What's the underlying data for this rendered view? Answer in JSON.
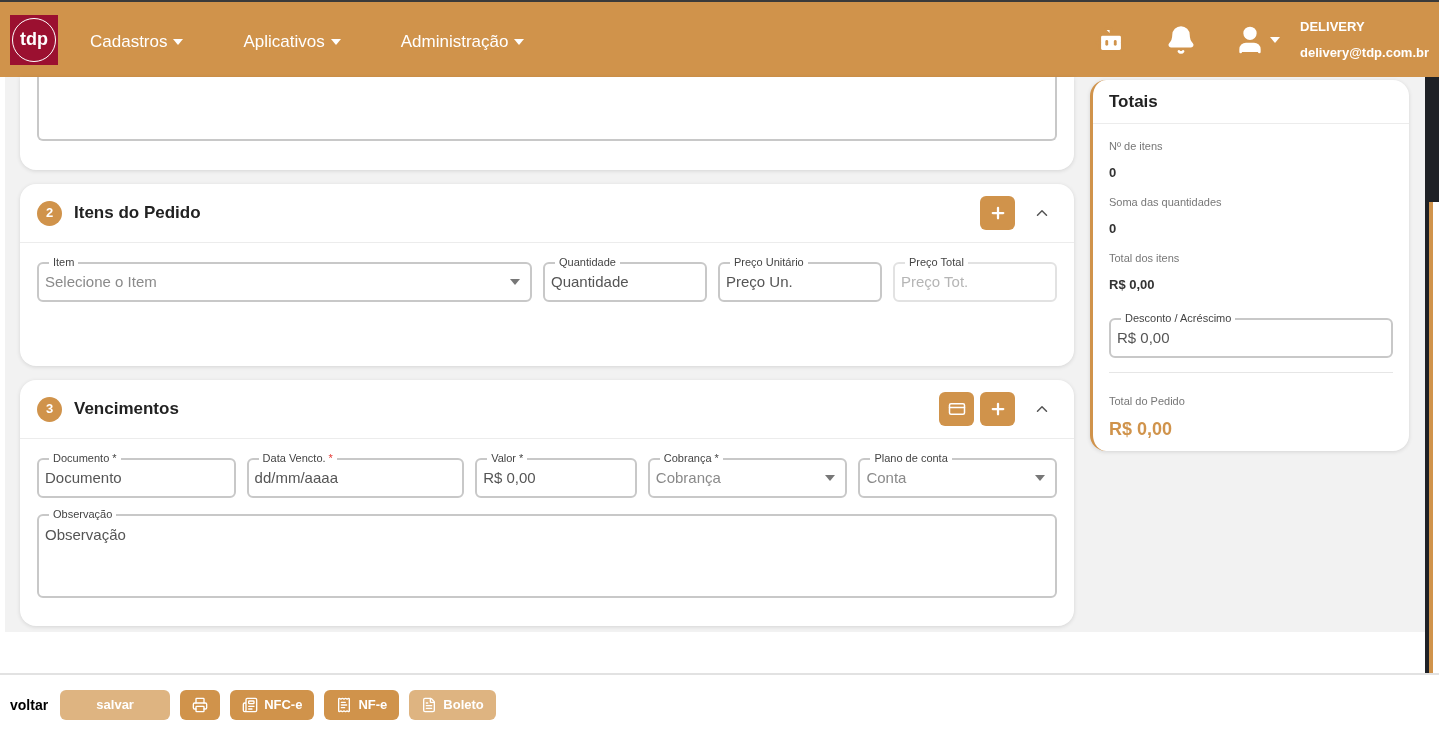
{
  "header": {
    "logo": "tdp",
    "menus": [
      "Cadastros",
      "Aplicativos",
      "Administração"
    ],
    "user": {
      "name": "DELIVERY",
      "email": "delivery@tdp.com.br"
    }
  },
  "sections": [
    {
      "number": "2",
      "title": "Itens do Pedido",
      "actions": [
        {
          "kind": "add"
        }
      ],
      "expanded": true,
      "rows": [
        [
          {
            "kind": "select",
            "label": "Item",
            "placeholder": "Selecione o Item",
            "disabled": false
          },
          {
            "kind": "input",
            "label": "Quantidade",
            "placeholder": "Quantidade",
            "disabled": false
          },
          {
            "kind": "input",
            "label": "Preço Unitário",
            "placeholder": "Preço Un.",
            "disabled": false
          },
          {
            "kind": "input",
            "label": "Preço Total",
            "placeholder": "Preço Tot.",
            "disabled": true
          }
        ]
      ]
    },
    {
      "number": "3",
      "title": "Vencimentos",
      "actions": [
        {
          "kind": "card"
        },
        {
          "kind": "add"
        }
      ],
      "expanded": true,
      "rows": [
        [
          {
            "kind": "input",
            "label": "Documento *",
            "placeholder": "Documento",
            "disabled": false
          },
          {
            "kind": "input",
            "label": "Data Vencto.",
            "required_mark": "*",
            "placeholder": "dd/mm/aaaa",
            "disabled": false
          },
          {
            "kind": "input",
            "label": "Valor *",
            "placeholder": "R$ 0,00",
            "disabled": false
          },
          {
            "kind": "select",
            "label": "Cobrança *",
            "placeholder": "Cobrança",
            "disabled": false
          },
          {
            "kind": "select",
            "label": "Plano de conta",
            "placeholder": "Conta",
            "disabled": false
          }
        ],
        [
          {
            "kind": "textarea",
            "label": "Observação",
            "placeholder": "Observação",
            "disabled": false
          }
        ]
      ]
    }
  ],
  "totals": {
    "title": "Totais",
    "stats": [
      {
        "label": "Nº de itens",
        "value": "0"
      },
      {
        "label": "Soma das quantidades",
        "value": "0"
      },
      {
        "label": "Total dos itens",
        "value": "R$ 0,00"
      }
    ],
    "discount": {
      "label": "Desconto / Acréscimo",
      "placeholder": "R$ 0,00"
    },
    "order_total": {
      "label": "Total do Pedido",
      "value": "R$ 0,00"
    }
  },
  "footer": {
    "back": "voltar",
    "buttons": [
      {
        "kind": "save",
        "label": "salvar",
        "disabled": true
      },
      {
        "kind": "print",
        "disabled": false
      },
      {
        "kind": "nfce",
        "label": "NFC-e",
        "disabled": false
      },
      {
        "kind": "nfe",
        "label": "NF-e",
        "disabled": false
      },
      {
        "kind": "boleto",
        "label": "Boleto",
        "disabled": true
      }
    ]
  }
}
